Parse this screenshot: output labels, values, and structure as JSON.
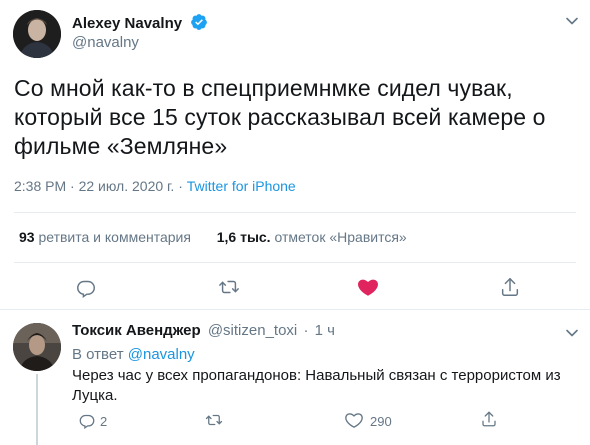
{
  "tweet": {
    "author_name": "Alexey Navalny",
    "author_handle": "@navalny",
    "verified_icon": "verified-badge-icon",
    "text": "Со мной как-то в спецприемнмке сидел чувак, который все 15 суток рассказывал всей камере о фильме «Земляне»",
    "timestamp": "2:38 PM · 22 июл. 2020 г.",
    "meta_separator": " · ",
    "source": "Twitter for iPhone",
    "retweets_count": "93",
    "retweets_label": "ретвита и комментария",
    "likes_count": "1,6 тыс.",
    "likes_label": "отметок «Нравится»",
    "like_color": "#e0245e",
    "accent_color": "#1b95e0"
  },
  "reply": {
    "author_name": "Токсик Авенджер",
    "author_handle": "@sitizen_toxi",
    "separator": "·",
    "time": "1 ч",
    "in_reply_to_label": "В ответ",
    "in_reply_to_handle": "@navalny",
    "text": "Через час у всех пропагандонов: Навальный связан с террористом из Луцка.",
    "reply_count": "2",
    "like_count": "290"
  }
}
